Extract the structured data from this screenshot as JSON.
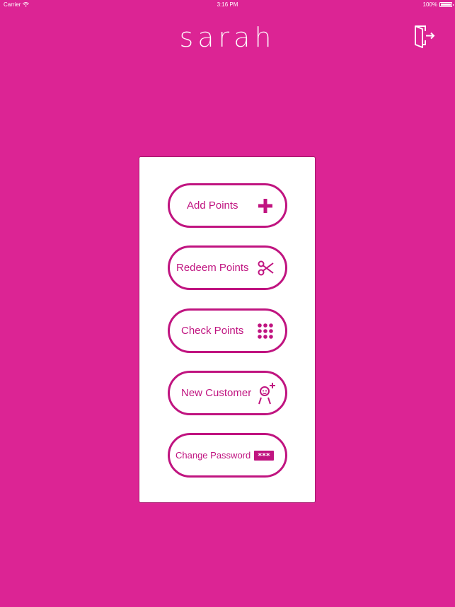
{
  "status_bar": {
    "carrier": "Carrier",
    "time": "3:16 PM",
    "battery": "100%"
  },
  "header": {
    "logo": "sarah",
    "logout_icon": "logout-door-icon"
  },
  "menu": {
    "items": [
      {
        "label": "Add Points",
        "icon": "plus-icon"
      },
      {
        "label": "Redeem Points",
        "icon": "scissors-icon"
      },
      {
        "label": "Check Points",
        "icon": "keypad-grid-icon"
      },
      {
        "label": "New Customer",
        "icon": "add-user-icon"
      },
      {
        "label": "Change Password",
        "icon": "password-dots-icon"
      }
    ]
  },
  "colors": {
    "background": "#dc2494",
    "accent": "#c01480",
    "card": "#ffffff"
  }
}
